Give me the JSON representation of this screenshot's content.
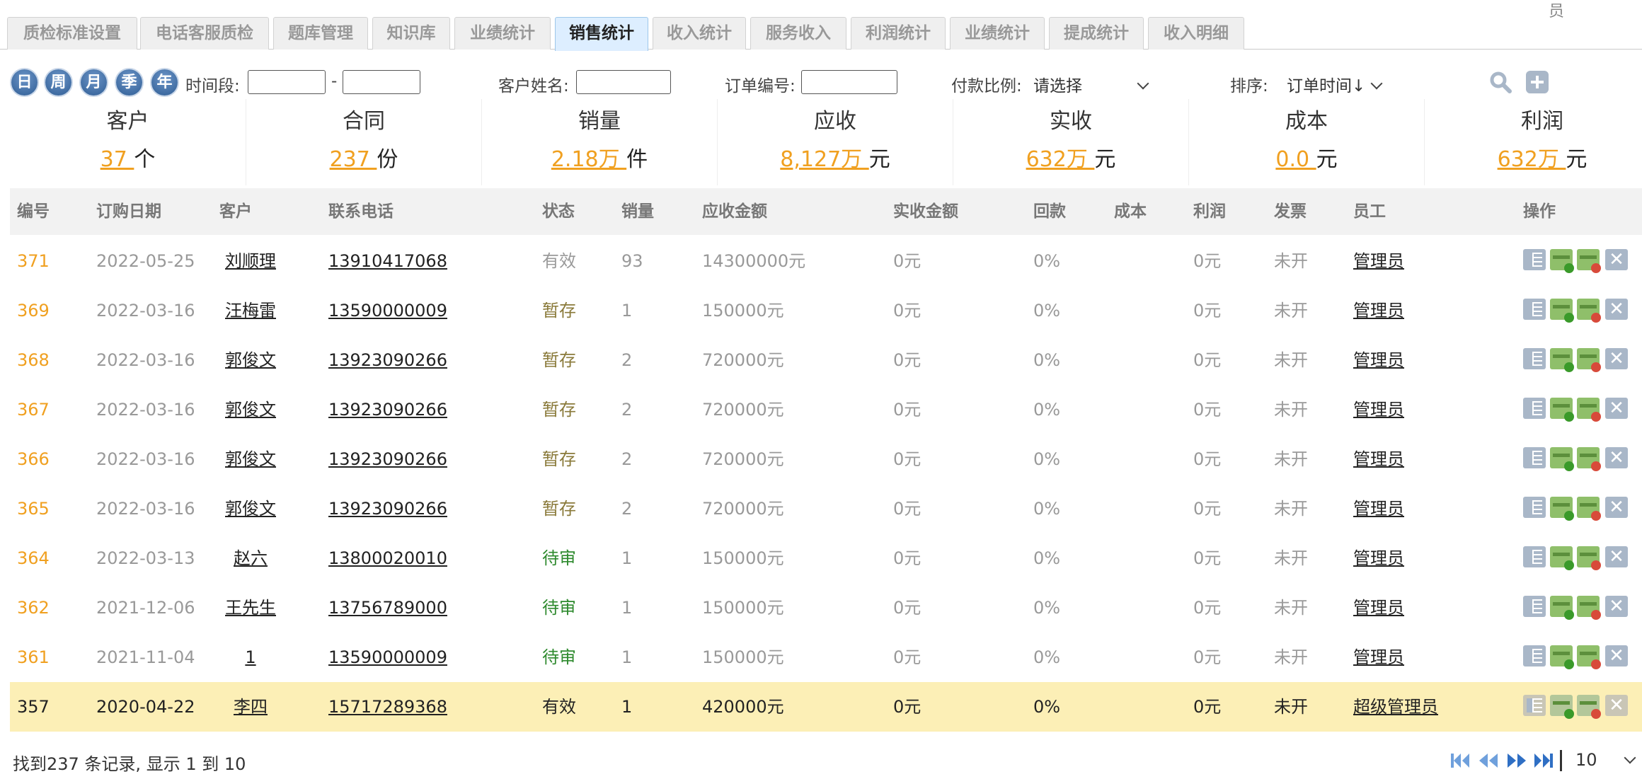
{
  "top_user": "员",
  "tabs": [
    {
      "label": "质检标准设置",
      "active": false
    },
    {
      "label": "电话客服质检",
      "active": false
    },
    {
      "label": "题库管理",
      "active": false
    },
    {
      "label": "知识库",
      "active": false
    },
    {
      "label": "业绩统计",
      "active": false
    },
    {
      "label": "销售统计",
      "active": true
    },
    {
      "label": "收入统计",
      "active": false
    },
    {
      "label": "服务收入",
      "active": false
    },
    {
      "label": "利润统计",
      "active": false
    },
    {
      "label": "业绩统计",
      "active": false
    },
    {
      "label": "提成统计",
      "active": false
    },
    {
      "label": "收入明细",
      "active": false
    }
  ],
  "filters": {
    "period_buttons": [
      "日",
      "周",
      "月",
      "季",
      "年"
    ],
    "time_label": "时间段:",
    "time_sep": "-",
    "time_start": "",
    "time_end": "",
    "customer_label": "客户姓名:",
    "customer_value": "",
    "order_label": "订单编号:",
    "order_value": "",
    "ratio_label": "付款比例:",
    "ratio_value": "请选择",
    "sort_label": "排序:",
    "sort_value": "订单时间↓"
  },
  "summary": [
    {
      "title": "客户",
      "value": "37 ",
      "unit": "个"
    },
    {
      "title": "合同",
      "value": "237 ",
      "unit": "份"
    },
    {
      "title": "销量",
      "value": "2.18万 ",
      "unit": "件"
    },
    {
      "title": "应收",
      "value": "8,127万 ",
      "unit": "元"
    },
    {
      "title": "实收",
      "value": "632万 ",
      "unit": "元"
    },
    {
      "title": "成本",
      "value": "0.0 ",
      "unit": "元"
    },
    {
      "title": "利润",
      "value": "632万 ",
      "unit": "元"
    }
  ],
  "table": {
    "headers": [
      "编号",
      "订购日期",
      "客户",
      "联系电话",
      "状态",
      "销量",
      "应收金额",
      "实收金额",
      "回款",
      "成本",
      "利润",
      "发票",
      "员工",
      "操作"
    ],
    "rows": [
      {
        "id": "371",
        "date": "2022-05-25",
        "customer": "刘顺理",
        "phone": "13910417068",
        "status": "有效",
        "status_type": "effective",
        "qty": "93",
        "receivable": "14300000元",
        "received": "0元",
        "return_rate": "0%",
        "cost": "",
        "profit": "0元",
        "invoice": "未开",
        "staff": "管理员"
      },
      {
        "id": "369",
        "date": "2022-03-16",
        "customer": "汪梅雷",
        "phone": "13590000009",
        "status": "暂存",
        "status_type": "draft",
        "qty": "1",
        "receivable": "150000元",
        "received": "0元",
        "return_rate": "0%",
        "cost": "",
        "profit": "0元",
        "invoice": "未开",
        "staff": "管理员"
      },
      {
        "id": "368",
        "date": "2022-03-16",
        "customer": "郭俊文",
        "phone": "13923090266",
        "status": "暂存",
        "status_type": "draft",
        "qty": "2",
        "receivable": "720000元",
        "received": "0元",
        "return_rate": "0%",
        "cost": "",
        "profit": "0元",
        "invoice": "未开",
        "staff": "管理员"
      },
      {
        "id": "367",
        "date": "2022-03-16",
        "customer": "郭俊文",
        "phone": "13923090266",
        "status": "暂存",
        "status_type": "draft",
        "qty": "2",
        "receivable": "720000元",
        "received": "0元",
        "return_rate": "0%",
        "cost": "",
        "profit": "0元",
        "invoice": "未开",
        "staff": "管理员"
      },
      {
        "id": "366",
        "date": "2022-03-16",
        "customer": "郭俊文",
        "phone": "13923090266",
        "status": "暂存",
        "status_type": "draft",
        "qty": "2",
        "receivable": "720000元",
        "received": "0元",
        "return_rate": "0%",
        "cost": "",
        "profit": "0元",
        "invoice": "未开",
        "staff": "管理员"
      },
      {
        "id": "365",
        "date": "2022-03-16",
        "customer": "郭俊文",
        "phone": "13923090266",
        "status": "暂存",
        "status_type": "draft",
        "qty": "2",
        "receivable": "720000元",
        "received": "0元",
        "return_rate": "0%",
        "cost": "",
        "profit": "0元",
        "invoice": "未开",
        "staff": "管理员"
      },
      {
        "id": "364",
        "date": "2022-03-13",
        "customer": "赵六",
        "phone": "13800020010",
        "status": "待审",
        "status_type": "pending",
        "qty": "1",
        "receivable": "150000元",
        "received": "0元",
        "return_rate": "0%",
        "cost": "",
        "profit": "0元",
        "invoice": "未开",
        "staff": "管理员"
      },
      {
        "id": "362",
        "date": "2021-12-06",
        "customer": "王先生",
        "phone": "13756789000",
        "status": "待审",
        "status_type": "pending",
        "qty": "1",
        "receivable": "150000元",
        "received": "0元",
        "return_rate": "0%",
        "cost": "",
        "profit": "0元",
        "invoice": "未开",
        "staff": "管理员"
      },
      {
        "id": "361",
        "date": "2021-11-04",
        "customer": "1",
        "phone": "13590000009",
        "status": "待审",
        "status_type": "pending",
        "qty": "1",
        "receivable": "150000元",
        "received": "0元",
        "return_rate": "0%",
        "cost": "",
        "profit": "0元",
        "invoice": "未开",
        "staff": "管理员"
      },
      {
        "id": "357",
        "date": "2020-04-22",
        "customer": "李四",
        "phone": "15717289368",
        "status": "有效",
        "status_type": "effective",
        "qty": "1",
        "receivable": "420000元",
        "received": "0元",
        "return_rate": "0%",
        "cost": "",
        "profit": "0元",
        "invoice": "未开",
        "staff": "超级管理员",
        "highlight": true
      }
    ]
  },
  "footer": {
    "records_text": "找到237 条记录, 显示 1 到 10",
    "page_size": "10"
  },
  "colors": {
    "accent_orange": "#f0a020",
    "tab_active_bg": "#ddeeff",
    "highlight_row": "#fcefb6",
    "pending_green": "#2e8a2e",
    "pager_blue": "#3a7fd0"
  }
}
